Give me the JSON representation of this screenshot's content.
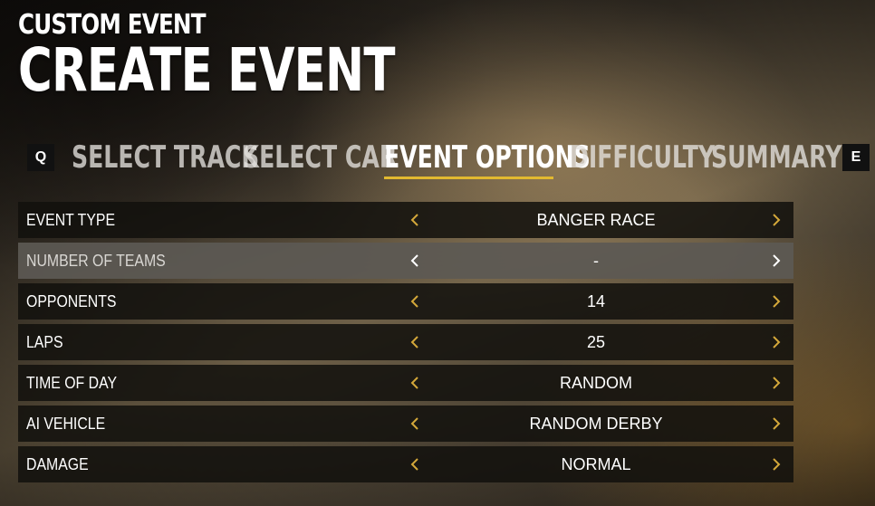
{
  "header": {
    "subtitle": "CUSTOM EVENT",
    "title": "CREATE EVENT"
  },
  "tabbar": {
    "prev_key": "Q",
    "next_key": "E",
    "tabs": [
      {
        "label": "SELECT TRACK",
        "active": false
      },
      {
        "label": "SELECT CAR",
        "active": false
      },
      {
        "label": "EVENT OPTIONS",
        "active": true
      },
      {
        "label": "DIFFICULTY",
        "active": false
      },
      {
        "label": "SUMMARY",
        "active": false
      }
    ]
  },
  "options": [
    {
      "label": "EVENT TYPE",
      "value": "BANGER RACE",
      "selected": false
    },
    {
      "label": "NUMBER OF TEAMS",
      "value": "-",
      "selected": true
    },
    {
      "label": "OPPONENTS",
      "value": "14",
      "selected": false
    },
    {
      "label": "LAPS",
      "value": "25",
      "selected": false
    },
    {
      "label": "TIME OF DAY",
      "value": "RANDOM",
      "selected": false
    },
    {
      "label": "AI VEHICLE",
      "value": "RANDOM DERBY",
      "selected": false
    },
    {
      "label": "DAMAGE",
      "value": "NORMAL",
      "selected": false
    }
  ],
  "icons": {
    "left": "chevron-left-icon",
    "right": "chevron-right-icon"
  },
  "colors": {
    "accent": "#e2b930",
    "arrow": "#d4a83a",
    "arrow_selected": "#ffffff",
    "row_bg": "#12100d",
    "row_selected_bg": "#5c5954"
  }
}
